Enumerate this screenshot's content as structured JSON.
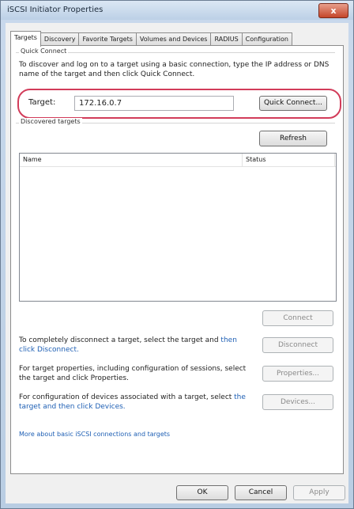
{
  "window": {
    "title": "iSCSI Initiator Properties",
    "close_label": "x"
  },
  "tabs": [
    {
      "label": "Targets",
      "active": true
    },
    {
      "label": "Discovery",
      "active": false
    },
    {
      "label": "Favorite Targets",
      "active": false
    },
    {
      "label": "Volumes and Devices",
      "active": false
    },
    {
      "label": "RADIUS",
      "active": false
    },
    {
      "label": "Configuration",
      "active": false
    }
  ],
  "quick_connect": {
    "group_label": "Quick Connect",
    "description": "To discover and log on to a target using a basic connection, type the IP address or DNS name of the target and then click Quick Connect.",
    "target_label": "Target:",
    "target_value": "172.16.0.7",
    "button_label": "Quick Connect..."
  },
  "discovered": {
    "group_label": "Discovered targets",
    "refresh_label": "Refresh",
    "columns": [
      "Name",
      "Status"
    ]
  },
  "actions": {
    "connect_label": "Connect",
    "disconnect_text_prefix": "To completely disconnect a target, select the target and ",
    "disconnect_text_link": "then click Disconnect.",
    "disconnect_label": "Disconnect",
    "properties_text_prefix": "For target properties, including configuration of sessions, ",
    "properties_text_suffix": "select the target and click Properties.",
    "properties_label": "Properties...",
    "devices_text_prefix": "For configuration of devices associated with a target, select ",
    "devices_text_link": "the target and then click Devices.",
    "devices_label": "Devices..."
  },
  "more_info_link": "More about basic iSCSI connections and targets",
  "dialog": {
    "ok_label": "OK",
    "cancel_label": "Cancel",
    "apply_label": "Apply"
  },
  "colors": {
    "highlight": "#d23c5a",
    "link": "#1e5fb4"
  }
}
